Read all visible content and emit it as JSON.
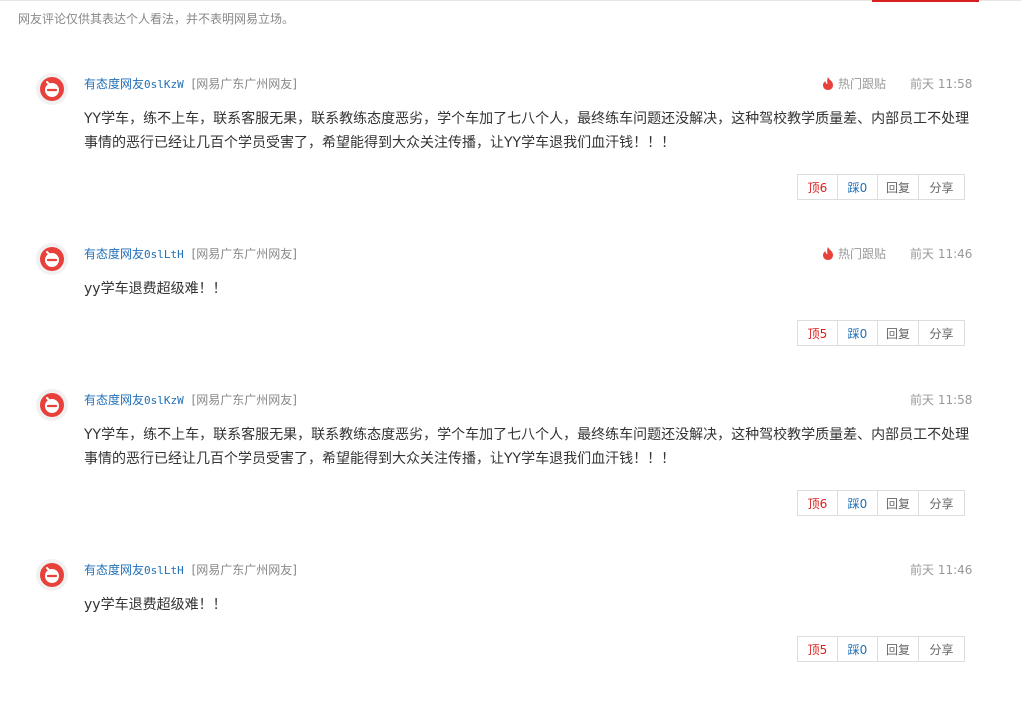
{
  "page": {
    "disclaimer": "网友评论仅供其表达个人看法，并不表明网易立场。"
  },
  "comments": [
    {
      "username": "有态度网友",
      "user_id": "0slKzW",
      "location": "[网易广东广州网友]",
      "hot_label": "热门跟贴",
      "time": "前天 11:58",
      "text": "YY学车，练不上车，联系客服无果，联系教练态度恶劣，学个车加了七八个人，最终练车问题还没解决，这种驾校教学质量差、内部员工不处理事情的恶行已经让几百个学员受害了，希望能得到大众关注传播，让YY学车退我们血汗钱！！！",
      "up": "顶6",
      "down": "踩0",
      "reply": "回复",
      "share": "分享"
    },
    {
      "username": "有态度网友",
      "user_id": "0slLtH",
      "location": "[网易广东广州网友]",
      "hot_label": "热门跟贴",
      "time": "前天 11:46",
      "text": "yy学车退费超级难！！",
      "up": "顶5",
      "down": "踩0",
      "reply": "回复",
      "share": "分享"
    },
    {
      "username": "有态度网友",
      "user_id": "0slKzW",
      "location": "[网易广东广州网友]",
      "time": "前天 11:58",
      "text": "YY学车，练不上车，联系客服无果，联系教练态度恶劣，学个车加了七八个人，最终练车问题还没解决，这种驾校教学质量差、内部员工不处理事情的恶行已经让几百个学员受害了，希望能得到大众关注传播，让YY学车退我们血汗钱！！！",
      "up": "顶6",
      "down": "踩0",
      "reply": "回复",
      "share": "分享"
    },
    {
      "username": "有态度网友",
      "user_id": "0slLtH",
      "location": "[网易广东广州网友]",
      "time": "前天 11:46",
      "text": "yy学车退费超级难！！",
      "up": "顶5",
      "down": "踩0",
      "reply": "回复",
      "share": "分享"
    }
  ],
  "colors": {
    "username": "#1f6fb7",
    "accent_red": "#d9201e",
    "muted": "#999999"
  },
  "icons": {
    "avatar": "netease-logo-avatar",
    "hot": "fire-icon"
  }
}
